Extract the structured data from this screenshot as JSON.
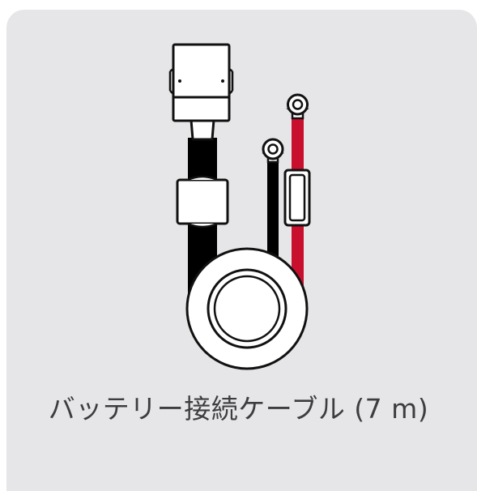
{
  "caption": "バッテリー接続ケーブル (7 m)",
  "colors": {
    "card_background": "#e6e6e8",
    "cable_black": "#000000",
    "cable_red": "#c8102e",
    "outline": "#111111",
    "fill_white": "#ffffff",
    "caption_text": "#3d3d3f"
  }
}
